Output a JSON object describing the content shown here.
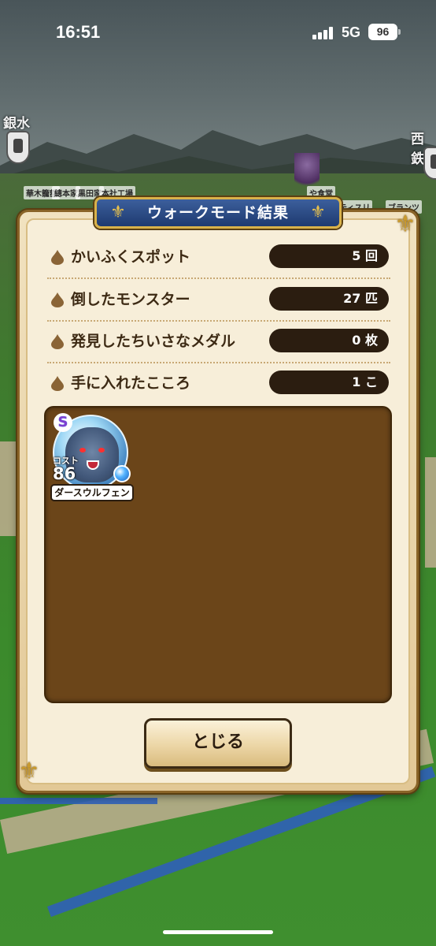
{
  "status_bar": {
    "time": "16:51",
    "network": "5G",
    "battery": "96"
  },
  "map": {
    "station_left": "銀水",
    "station_right": "西鉄",
    "labels": [
      "華木籠額",
      "總本家",
      "黒田家",
      "本社工場",
      "や食堂",
      "ティスリ",
      "ブランツ"
    ]
  },
  "dialog": {
    "title": "ウォークモード結果",
    "rows": [
      {
        "label": "かいふくスポット",
        "value": "5 回"
      },
      {
        "label": "倒したモンスター",
        "value": "27 匹"
      },
      {
        "label": "発見したちいさなメダル",
        "value": "0 枚"
      },
      {
        "label": "手に入れたこころ",
        "value": "1 こ"
      }
    ],
    "monster": {
      "rank": "S",
      "cost_label": "コスト",
      "cost": "86",
      "name": "ダースウルフェン",
      "element_icon": "water-element-icon"
    },
    "close_label": "とじる"
  },
  "colors": {
    "title_plate": "#1e3a70",
    "frame_gold": "#c99a2e",
    "panel_brown": "#6b4519",
    "value_pill": "#2b1d10"
  }
}
